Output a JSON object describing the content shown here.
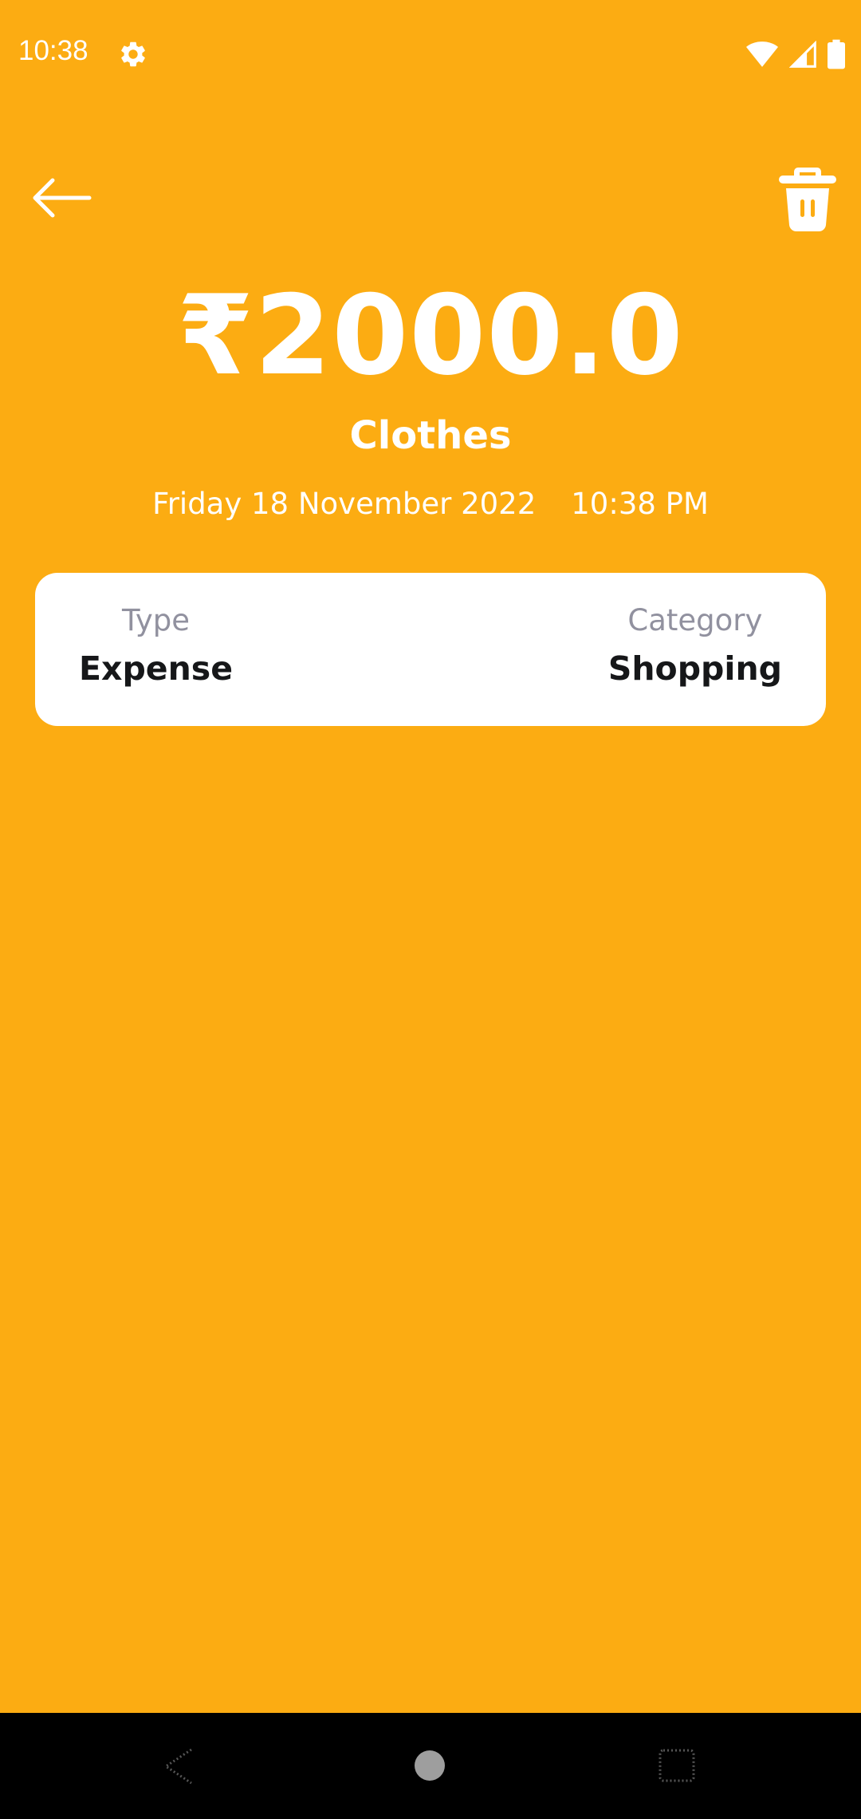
{
  "status_bar": {
    "time": "10:38",
    "icons": [
      "gear-icon",
      "wifi-icon",
      "signal-icon",
      "battery-icon"
    ]
  },
  "header": {
    "back_icon": "arrow-left-icon",
    "delete_icon": "trash-icon"
  },
  "transaction": {
    "amount": "₹2000.0",
    "title": "Clothes",
    "date": "Friday 18 November 2022",
    "time": "10:38 PM"
  },
  "details": {
    "type_label": "Type",
    "type_value": "Expense",
    "category_label": "Category",
    "category_value": "Shopping"
  },
  "nav_bar": {
    "icons": [
      "nav-back-icon",
      "nav-home-icon",
      "nav-recents-icon"
    ]
  },
  "colors": {
    "background": "#FCAC12",
    "card": "#FFFFFF",
    "label": "#91919F",
    "value": "#161719"
  }
}
